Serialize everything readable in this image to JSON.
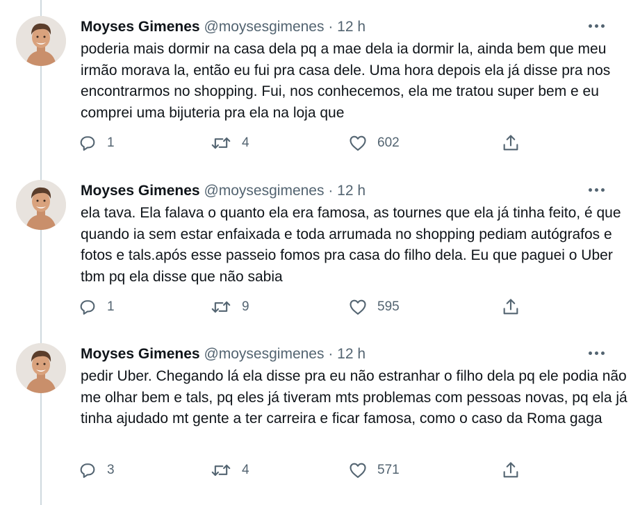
{
  "tweets": [
    {
      "name": "Moyses Gimenes",
      "handle": "@moysesgimenes",
      "separator": "·",
      "time": "12 h",
      "text": "poderia mais dormir na casa dela pq a mae dela ia dormir la, ainda bem que meu irmão morava la, então eu fui pra casa dele. Uma hora depois ela já disse pra nos encontrarmos no shopping. Fui, nos conhecemos, ela me tratou super bem e eu comprei uma bijuteria pra ela na loja que",
      "replies": "1",
      "retweets": "4",
      "likes": "602"
    },
    {
      "name": "Moyses Gimenes",
      "handle": "@moysesgimenes",
      "separator": "·",
      "time": "12 h",
      "text": "ela tava. Ela falava o quanto ela era famosa, as tournes que ela já tinha feito, é que quando ia sem estar enfaixada e toda arrumada no shopping pediam autógrafos e fotos e tals.após esse passeio fomos pra casa do filho dela. Eu que paguei o Uber tbm pq ela disse que não sabia",
      "replies": "1",
      "retweets": "9",
      "likes": "595"
    },
    {
      "name": "Moyses Gimenes",
      "handle": "@moysesgimenes",
      "separator": "·",
      "time": "12 h",
      "text": "pedir Uber. Chegando lá ela disse pra eu não estranhar o filho dela pq ele podia não me olhar bem e tals, pq eles já tiveram mts problemas com pessoas novas, pq ela já tinha ajudado mt gente a ter carreira e ficar famosa, como o caso da Roma gaga",
      "replies": "3",
      "retweets": "4",
      "likes": "571"
    }
  ],
  "icons": {
    "more": "more-horizontal-icon",
    "reply": "reply-icon",
    "retweet": "retweet-icon",
    "like": "heart-icon",
    "share": "share-icon"
  },
  "colors": {
    "text": "#0f1419",
    "secondary": "#536471",
    "thread_line": "#cfd9de",
    "background": "#ffffff"
  }
}
